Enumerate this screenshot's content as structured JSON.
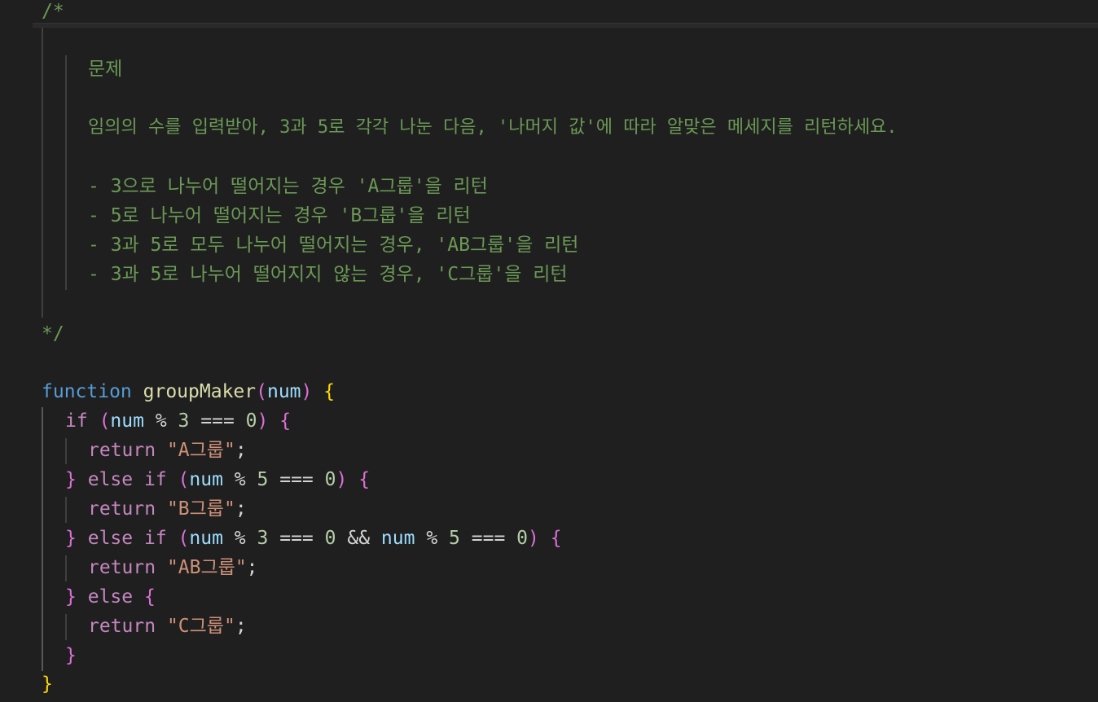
{
  "editor": {
    "comment": {
      "open": "/*",
      "close": "*/",
      "title": "문제",
      "description": "임의의 수를 입력받아, 3과 5로 각각 나눈 다음, '나머지 값'에 따라 알맞은 메세지를 리턴하세요.",
      "rules": [
        "- 3으로 나누어 떨어지는 경우 'A그룹'을 리턴",
        "- 5로 나누어 떨어지는 경우 'B그룹'을 리턴",
        "- 3과 5로 모두 나누어 떨어지는 경우, 'AB그룹'을 리턴",
        "- 3과 5로 나누어 떨어지지 않는 경우, 'C그룹'을 리턴"
      ]
    },
    "code": {
      "keyword_function": "function",
      "fn_name": "groupMaker",
      "param": "num",
      "kw_if": "if",
      "kw_else": "else",
      "kw_return": "return",
      "var": "num",
      "op_mod": "%",
      "op_eq": "===",
      "op_and": "&&",
      "n3": "3",
      "n5": "5",
      "n0": "0",
      "str_a": "\"A그룹\"",
      "str_b": "\"B그룹\"",
      "str_ab": "\"AB그룹\"",
      "str_c": "\"C그룹\"",
      "semi": ";",
      "lparen": "(",
      "rparen": ")",
      "lbrace": "{",
      "rbrace": "}"
    },
    "colors": {
      "background": "#1f1f1f",
      "comment": "#6a9955",
      "keyword": "#569cd6",
      "control": "#c586c0",
      "function": "#dcdcaa",
      "variable": "#9cdcfe",
      "number": "#b5cea8",
      "string": "#ce9178"
    }
  }
}
